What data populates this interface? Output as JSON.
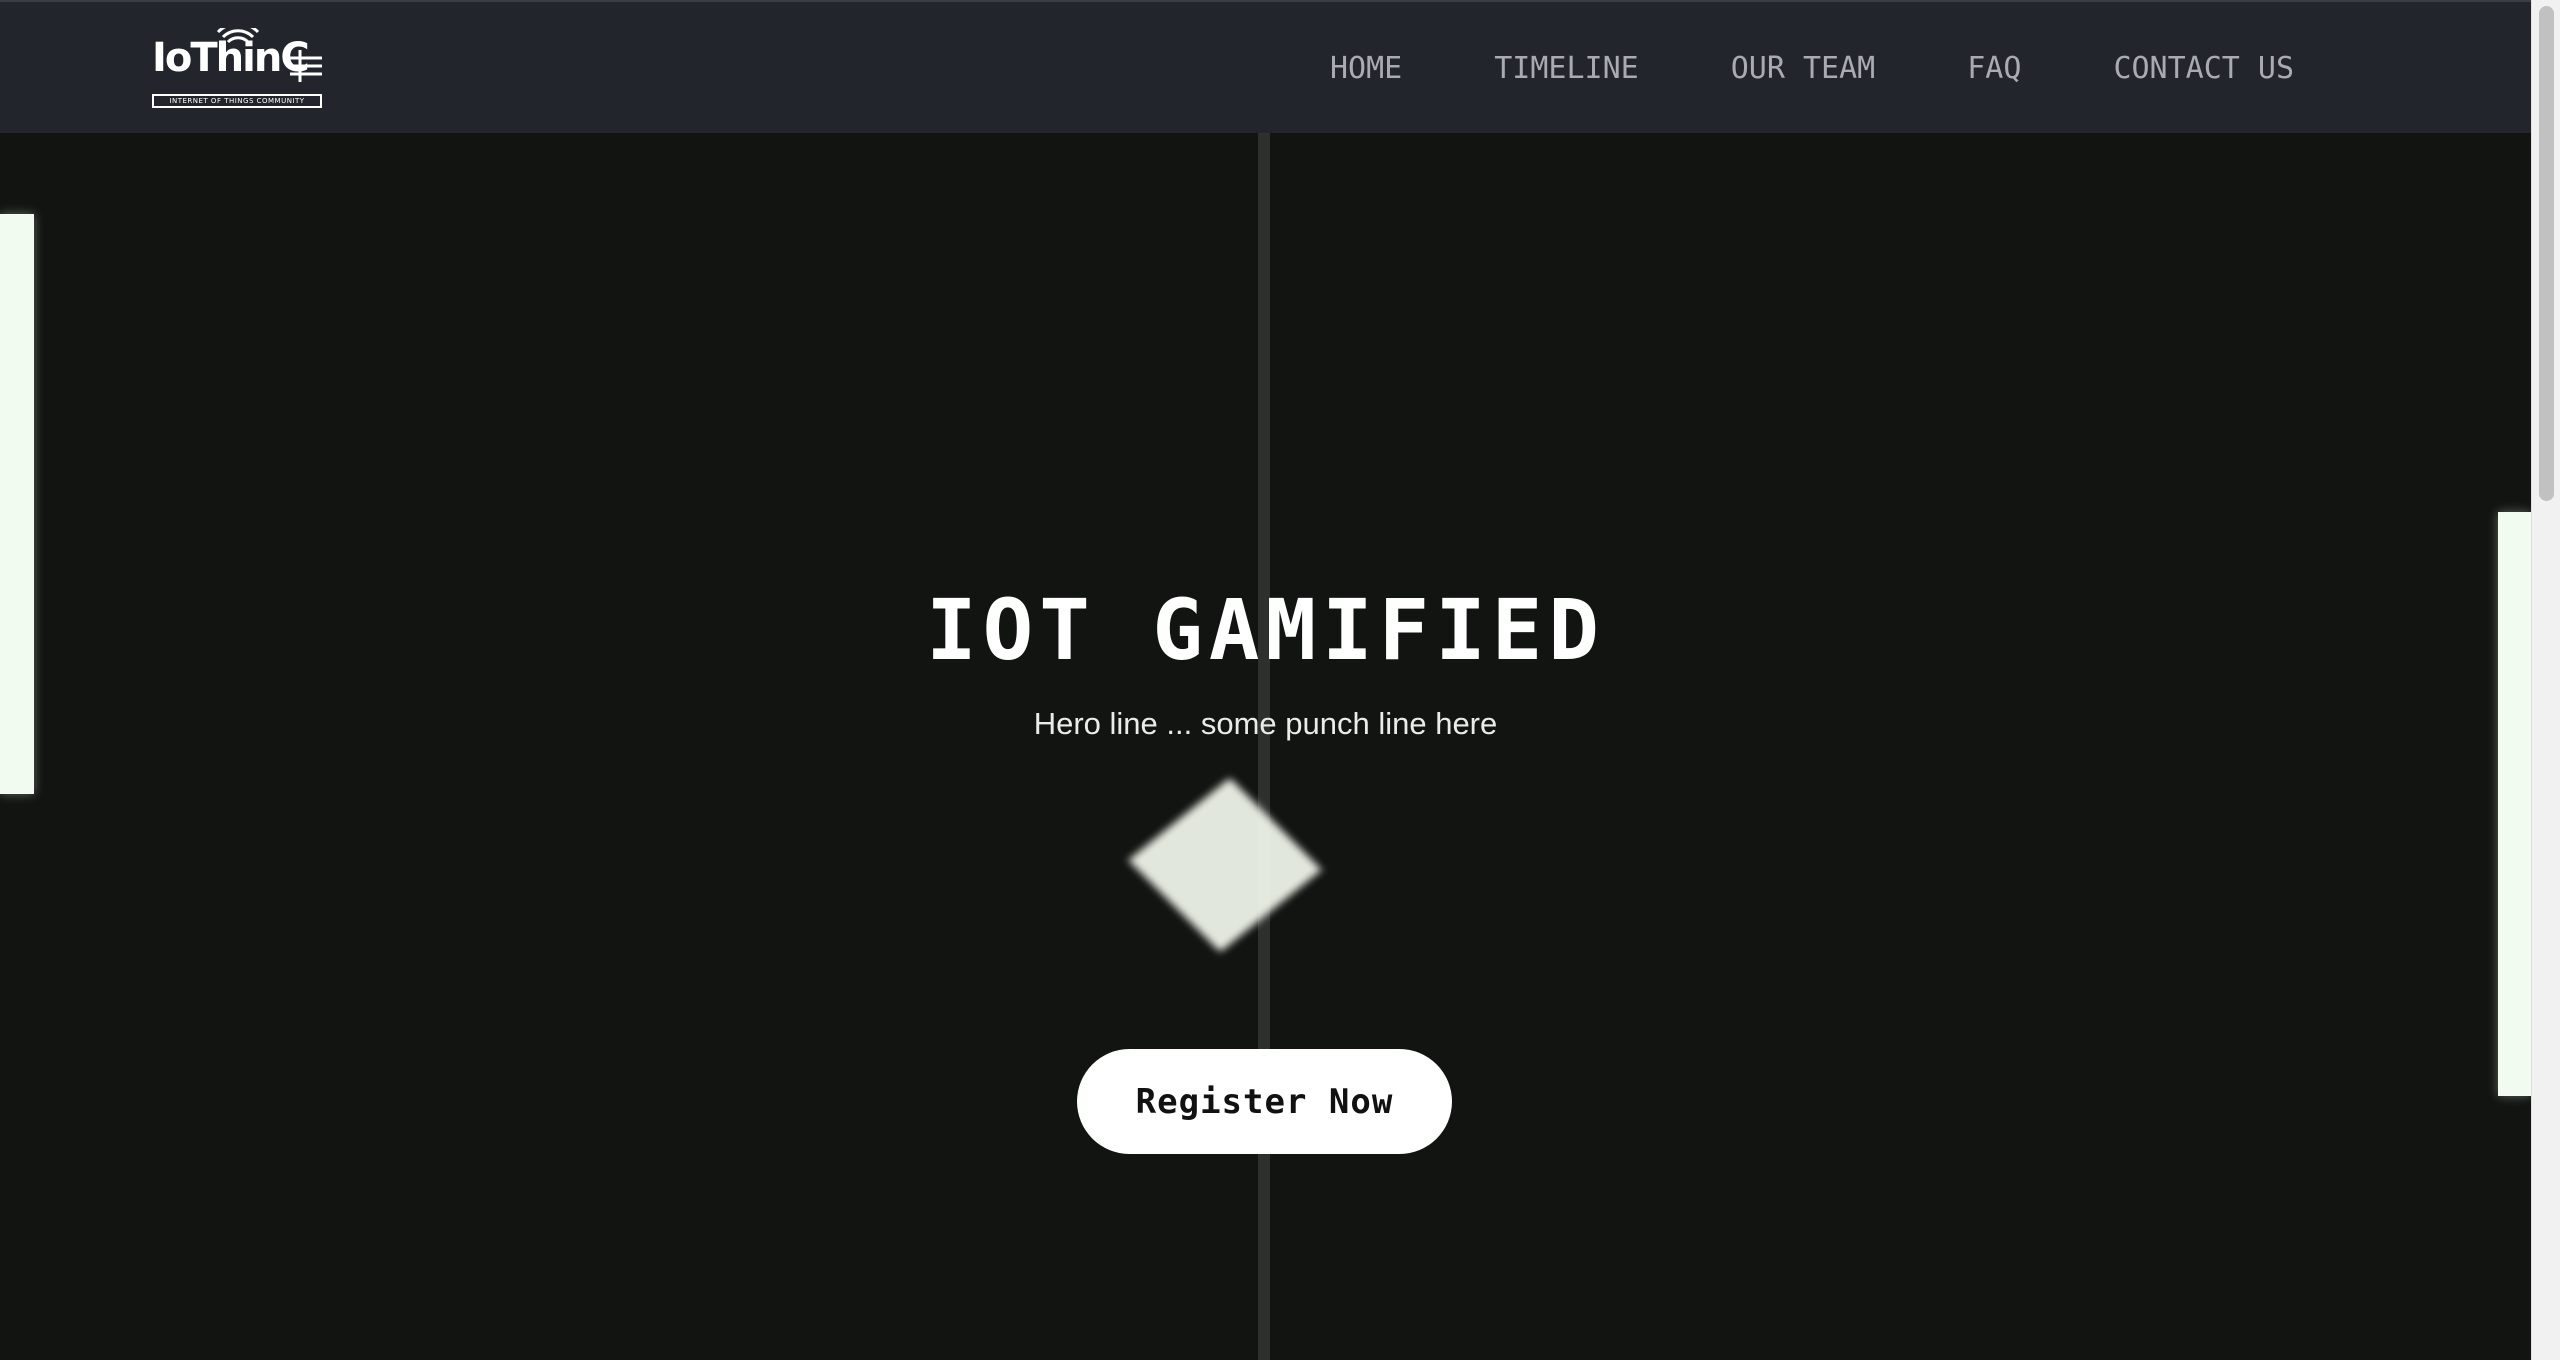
{
  "logo": {
    "name": "IoThinC",
    "tagline": "INTERNET OF THINGS COMMUNITY"
  },
  "nav": {
    "items": [
      {
        "label": "HOME"
      },
      {
        "label": "TIMELINE"
      },
      {
        "label": "OUR TEAM"
      },
      {
        "label": "FAQ"
      },
      {
        "label": "CONTACT US"
      }
    ]
  },
  "hero": {
    "title": "IOT GAMIFIED",
    "subtitle": "Hero line ... some punch line here",
    "cta_label": "Register Now"
  },
  "colors": {
    "background": "#121412",
    "navbar": "#22252b",
    "nav_text": "#a9abb0",
    "paddle": "#f2fbef",
    "button_bg": "#ffffff",
    "button_text": "#111111"
  }
}
